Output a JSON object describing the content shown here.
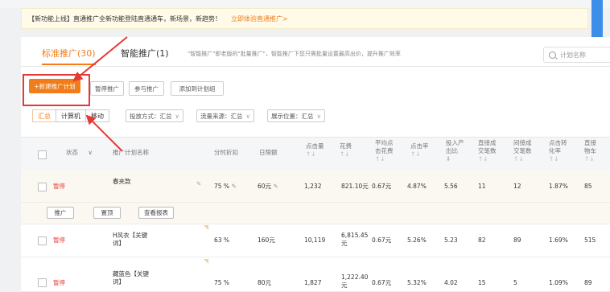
{
  "notice": {
    "text": "【新功能上线】直通推广全新功能登陆直通通车，新场景，新趋势！",
    "link": "立即体验直通推广>"
  },
  "tabs": [
    {
      "label": "标准推广(30)"
    },
    {
      "label": "智能推广(1)"
    }
  ],
  "tab_description": "\"智能推广\"即老版的\"批量推广\"，智能推广下您只需批量设置最高出价，提升推广效率",
  "search": {
    "placeholder": "计划名称"
  },
  "toolbar": {
    "new_plan": "+新建推广计划",
    "pause": "暂停推广",
    "join": "参与推广",
    "add_group": "添加到计划组"
  },
  "device_seg": [
    "汇总",
    "计算机",
    "移动"
  ],
  "filters": [
    "投放方式：汇总",
    "流量来源：汇总",
    "展示位置：汇总"
  ],
  "columns": {
    "status": "状态",
    "name": "推广计划名称",
    "discount": "分时折扣",
    "budget": "日限额",
    "clicks": "点击量",
    "cost": "花费",
    "avg_cpc_1": "平均点",
    "avg_cpc_2": "击花费",
    "ctr": "点击率",
    "roi_1": "投入产",
    "roi_2": "出比",
    "direct_1": "直接成",
    "direct_2": "交笔数",
    "indirect_1": "间接成",
    "indirect_2": "交笔数",
    "conv_1": "点击转",
    "conv_2": "化率",
    "fav_1": "直接",
    "fav_2": "物车"
  },
  "rows": [
    {
      "status": "暂停",
      "name": "春夹款",
      "name2": "",
      "discount": "75 %",
      "budget": "60元",
      "clicks": "1,232",
      "cost": "821.10元",
      "cost2": "",
      "cpc": "0.67元",
      "ctr": "4.87%",
      "roi": "5.56",
      "direct": "11",
      "indirect": "12",
      "conv": "1.87%",
      "fav": "85"
    },
    {
      "status": "暂停",
      "name": "H风衣【关键",
      "name2": "词】",
      "discount": "63 %",
      "budget": "160元",
      "clicks": "10,119",
      "cost": "6,815.45",
      "cost2": "元",
      "cpc": "0.67元",
      "ctr": "5.26%",
      "roi": "5.23",
      "direct": "82",
      "indirect": "89",
      "conv": "1.69%",
      "fav": "515"
    },
    {
      "status": "暂停",
      "name": "藏蓝色【关键",
      "name2": "词】",
      "discount": "75 %",
      "budget": "80元",
      "clicks": "1,827",
      "cost": "1,222.40",
      "cost2": "元",
      "cpc": "0.67元",
      "ctr": "5.32%",
      "roi": "4.02",
      "direct": "15",
      "indirect": "5",
      "conv": "1.09%",
      "fav": "89"
    }
  ],
  "row_actions": [
    "推广",
    "置顶",
    "查看报表"
  ],
  "colors": {
    "accent": "#f07d1a",
    "annotation": "#e53935"
  }
}
